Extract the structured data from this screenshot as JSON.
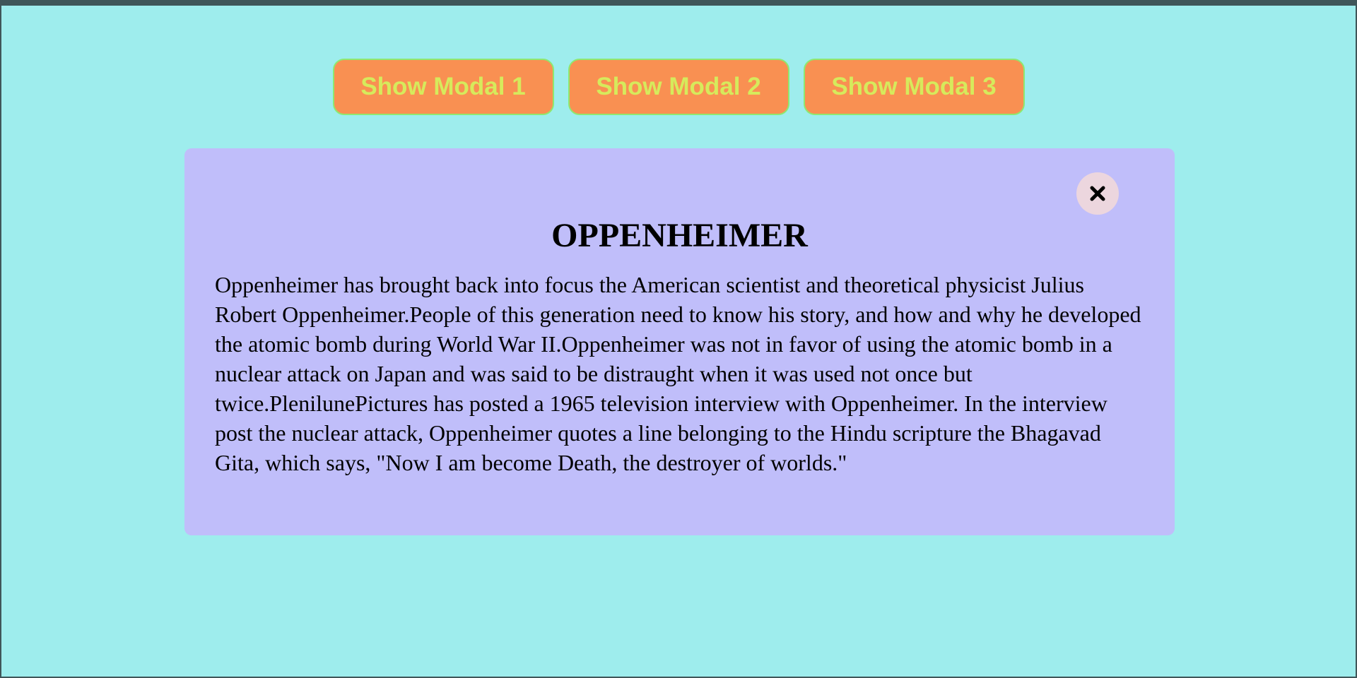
{
  "buttons": {
    "modal1_label": "Show Modal 1",
    "modal2_label": "Show Modal 2",
    "modal3_label": "Show Modal 3"
  },
  "modal": {
    "title": "OPPENHEIMER",
    "close_icon": "close-icon",
    "body": "Oppenheimer has brought back into focus the American scientist and theoretical physicist Julius Robert Oppenheimer.People of this generation need to know his story, and how and why he developed the atomic bomb during World War II.Oppenheimer was not in favor of using the atomic bomb in a nuclear attack on Japan and was said to be distraught when it was used not once but twice.PlenilunePictures has posted a 1965 television interview with Oppenheimer. In the interview post the nuclear attack, Oppenheimer quotes a line belonging to the Hindu scripture the Bhagavad Gita, which says, \"Now I am become Death, the destroyer of worlds.\""
  },
  "colors": {
    "page_background": "#9eeded",
    "button_background": "#f99052",
    "button_text": "#d6ea5c",
    "button_border": "#8ee870",
    "modal_background": "#c0befa",
    "close_button_background": "#ecd6de"
  }
}
